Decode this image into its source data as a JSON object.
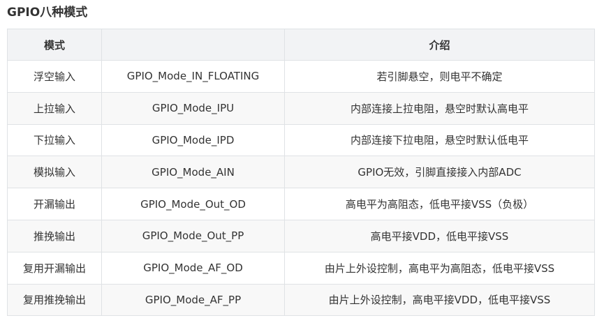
{
  "title": "GPIO八种模式",
  "table": {
    "headers": [
      "模式",
      "",
      "介绍"
    ],
    "rows": [
      [
        "浮空输入",
        "GPIO_Mode_IN_FLOATING",
        "若引脚悬空，则电平不确定"
      ],
      [
        "上拉输入",
        "GPIO_Mode_IPU",
        "内部连接上拉电阻，悬空时默认高电平"
      ],
      [
        "下拉输入",
        "GPIO_Mode_IPD",
        "内部连接下拉电阻，悬空时默认低电平"
      ],
      [
        "模拟输入",
        "GPIO_Mode_AIN",
        "GPIO无效，引脚直接接入内部ADC"
      ],
      [
        "开漏输出",
        "GPIO_Mode_Out_OD",
        "高电平为高阻态，低电平接VSS（负极）"
      ],
      [
        "推挽输出",
        "GPIO_Mode_Out_PP",
        "高电平接VDD，低电平接VSS"
      ],
      [
        "复用开漏输出",
        "GPIO_Mode_AF_OD",
        "由片上外设控制，高电平为高阻态，低电平接VSS"
      ],
      [
        "复用推挽输出",
        "GPIO_Mode_AF_PP",
        "由片上外设控制，高电平接VDD，低电平接VSS"
      ]
    ]
  }
}
